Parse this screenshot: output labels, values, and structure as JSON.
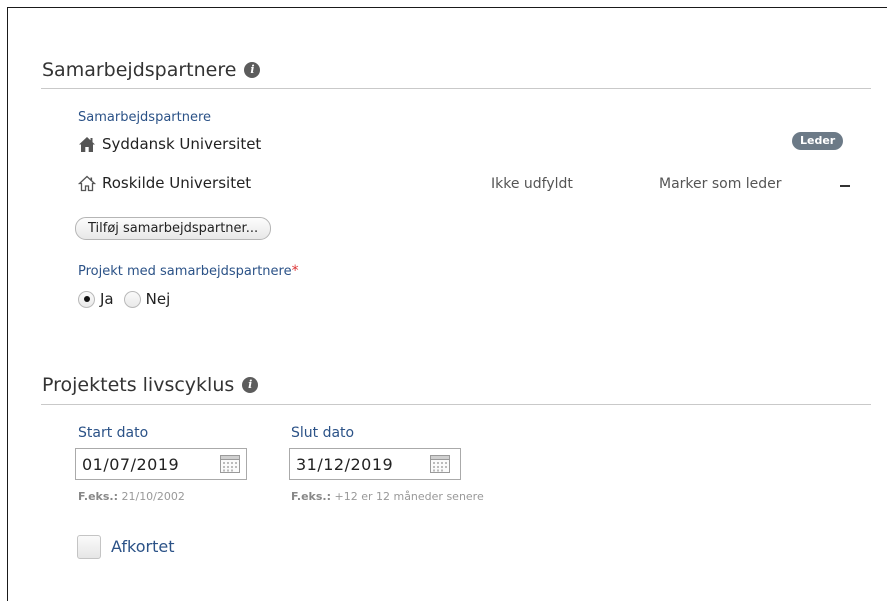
{
  "partners_section": {
    "title": "Samarbejdspartnere",
    "info_icon": "info-icon",
    "field_label": "Samarbejdspartnere",
    "partners": [
      {
        "name": "Syddansk Universitet",
        "icon": "home-icon",
        "badge": "Leder"
      },
      {
        "name": "Roskilde Universitet",
        "icon": "home-outline-icon",
        "status": "Ikke udfyldt",
        "action": "Marker som leder",
        "remove": "remove-dash"
      }
    ],
    "add_button": "Tilføj samarbejdspartner...",
    "with_partners_label": "Projekt med samarbejdspartnere",
    "required_mark": "*",
    "radio_options": [
      {
        "label": "Ja",
        "selected": true
      },
      {
        "label": "Nej",
        "selected": false
      }
    ]
  },
  "lifecycle_section": {
    "title": "Projektets livscyklus",
    "info_icon": "info-icon",
    "start": {
      "label": "Start dato",
      "value": "01/07/2019",
      "hint_prefix": "F.eks.:",
      "hint_text": "21/10/2002"
    },
    "end": {
      "label": "Slut dato",
      "value": "31/12/2019",
      "hint_prefix": "F.eks.:",
      "hint_text": "+12 er 12 måneder senere"
    },
    "shortened_label": "Afkortet",
    "shortened_checked": false
  },
  "colors": {
    "label_blue": "#2b5287",
    "badge_gray": "#6c7a87",
    "required_red": "#dd3333"
  }
}
